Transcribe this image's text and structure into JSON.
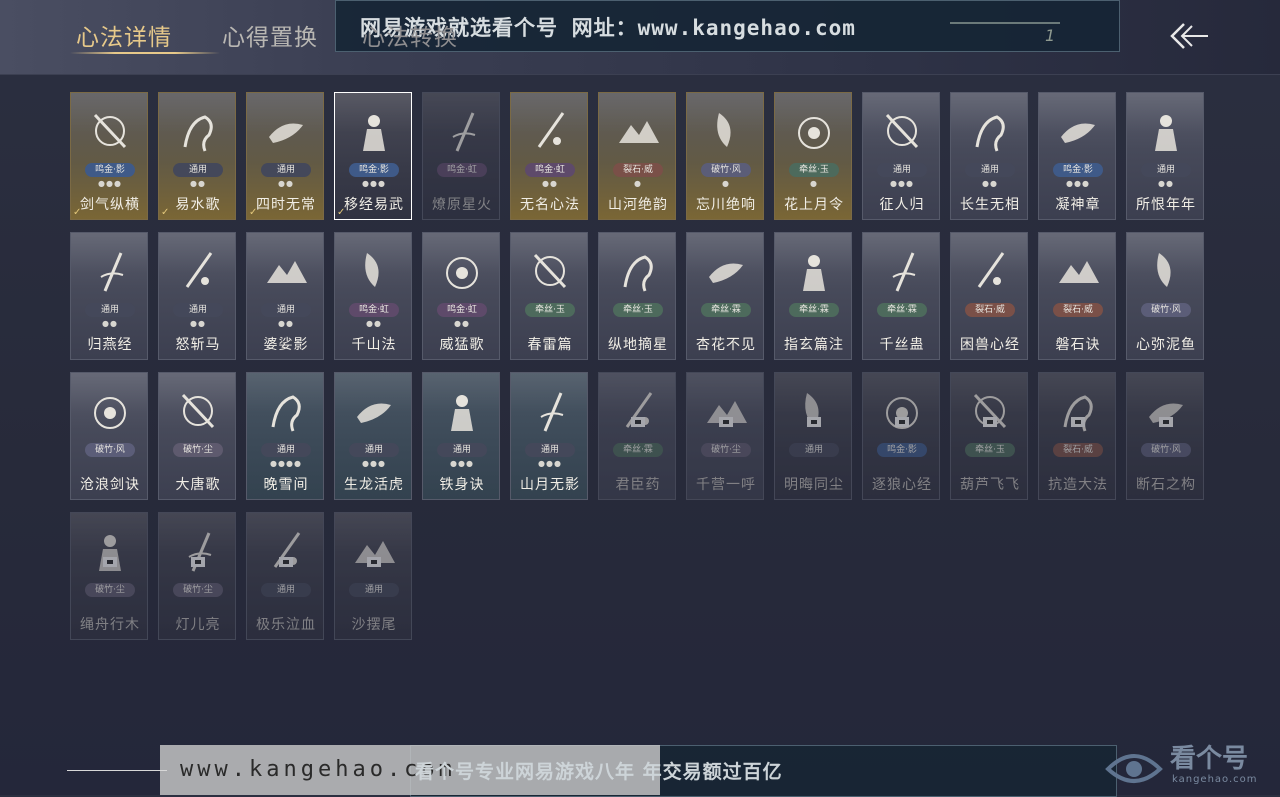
{
  "tabs": [
    {
      "label": "心法详情",
      "active": true
    },
    {
      "label": "心得置换",
      "active": false
    },
    {
      "label": "心法转换",
      "active": false
    }
  ],
  "watermark_top": "网易游戏就选看个号  网址：www.kangehao.com",
  "banner_number": "1",
  "bottom_url": "www.kangehao.com",
  "bottom_slogan": "看个号专业网易游戏八年  年交易额过百亿",
  "brand_name": "看个号",
  "brand_url": "kangehao.com",
  "cards": [
    {
      "name": "剑气纵横",
      "badge": "鸣金·影",
      "dots": "●●●",
      "style": "gold",
      "badge_style": "b-ying",
      "checked": true
    },
    {
      "name": "易水歌",
      "badge": "通用",
      "dots": "●●",
      "style": "gold",
      "badge_style": "b-common",
      "checked": true
    },
    {
      "name": "四时无常",
      "badge": "通用",
      "dots": "●●",
      "style": "gold",
      "badge_style": "b-common",
      "checked": true
    },
    {
      "name": "移经易武",
      "badge": "鸣金·影",
      "dots": "●●●",
      "style": "dark",
      "badge_style": "b-ying",
      "checked": true,
      "selected": true
    },
    {
      "name": "燎原星火",
      "badge": "鸣金·虹",
      "dots": "",
      "style": "dark",
      "badge_style": "b-hong",
      "faded": true
    },
    {
      "name": "无名心法",
      "badge": "鸣金·虹",
      "dots": "●●",
      "style": "gold",
      "badge_style": "b-hong"
    },
    {
      "name": "山河绝韵",
      "badge": "裂石·威",
      "dots": "●",
      "style": "gold",
      "badge_style": "b-wei"
    },
    {
      "name": "忘川绝响",
      "badge": "破竹·风",
      "dots": "●",
      "style": "gold",
      "badge_style": "b-feng"
    },
    {
      "name": "花上月令",
      "badge": "牵丝·玉",
      "dots": "●",
      "style": "gold",
      "badge_style": "b-yu"
    },
    {
      "name": "征人归",
      "badge": "通用",
      "dots": "●●●",
      "style": "normal",
      "badge_style": "b-common"
    },
    {
      "name": "长生无相",
      "badge": "通用",
      "dots": "●●",
      "style": "normal",
      "badge_style": "b-common"
    },
    {
      "name": "凝神章",
      "badge": "鸣金·影",
      "dots": "●●●",
      "style": "normal",
      "badge_style": "b-ying"
    },
    {
      "name": "所恨年年",
      "badge": "通用",
      "dots": "●●",
      "style": "normal",
      "badge_style": "b-common"
    },
    {
      "name": "归燕经",
      "badge": "通用",
      "dots": "●●",
      "style": "normal",
      "badge_style": "b-common"
    },
    {
      "name": "怒斩马",
      "badge": "通用",
      "dots": "●●",
      "style": "normal",
      "badge_style": "b-common"
    },
    {
      "name": "婆娑影",
      "badge": "通用",
      "dots": "●●",
      "style": "normal",
      "badge_style": "b-common"
    },
    {
      "name": "千山法",
      "badge": "鸣金·虹",
      "dots": "●●",
      "style": "normal",
      "badge_style": "b-hong"
    },
    {
      "name": "威猛歌",
      "badge": "鸣金·虹",
      "dots": "●●",
      "style": "normal",
      "badge_style": "b-hong"
    },
    {
      "name": "春雷篇",
      "badge": "牵丝·玉",
      "dots": "",
      "style": "normal",
      "badge_style": "b-yu"
    },
    {
      "name": "纵地摘星",
      "badge": "牵丝·玉",
      "dots": "",
      "style": "normal",
      "badge_style": "b-yu"
    },
    {
      "name": "杏花不见",
      "badge": "牵丝·霖",
      "dots": "",
      "style": "normal",
      "badge_style": "b-yu"
    },
    {
      "name": "指玄篇注",
      "badge": "牵丝·霖",
      "dots": "",
      "style": "normal",
      "badge_style": "b-yu"
    },
    {
      "name": "千丝蛊",
      "badge": "牵丝·霖",
      "dots": "",
      "style": "normal",
      "badge_style": "b-yu"
    },
    {
      "name": "困兽心经",
      "badge": "裂石·威",
      "dots": "",
      "style": "normal",
      "badge_style": "b-wei"
    },
    {
      "name": "磐石诀",
      "badge": "裂石·威",
      "dots": "",
      "style": "normal",
      "badge_style": "b-wei"
    },
    {
      "name": "心弥泥鱼",
      "badge": "破竹·风",
      "dots": "",
      "style": "normal",
      "badge_style": "b-feng"
    },
    {
      "name": "沧浪剑诀",
      "badge": "破竹·风",
      "dots": "",
      "style": "normal",
      "badge_style": "b-feng"
    },
    {
      "name": "大唐歌",
      "badge": "破竹·尘",
      "dots": "",
      "style": "normal",
      "badge_style": "b-chen"
    },
    {
      "name": "晚雪间",
      "badge": "通用",
      "dots": "●●●●",
      "style": "teal",
      "badge_style": "b-common"
    },
    {
      "name": "生龙活虎",
      "badge": "通用",
      "dots": "●●●",
      "style": "teal",
      "badge_style": "b-common"
    },
    {
      "name": "铁身诀",
      "badge": "通用",
      "dots": "●●●",
      "style": "teal",
      "badge_style": "b-common"
    },
    {
      "name": "山月无影",
      "badge": "通用",
      "dots": "●●●",
      "style": "teal",
      "badge_style": "b-common"
    },
    {
      "name": "君臣药",
      "badge": "牵丝·霖",
      "dots": "",
      "style": "normal",
      "badge_style": "b-yu",
      "locked": true
    },
    {
      "name": "千营一呼",
      "badge": "破竹·尘",
      "dots": "",
      "style": "normal",
      "badge_style": "b-chen",
      "locked": true
    },
    {
      "name": "明晦同尘",
      "badge": "通用",
      "dots": "",
      "style": "dark",
      "badge_style": "b-common",
      "locked": true
    },
    {
      "name": "逐狼心经",
      "badge": "鸣金·影",
      "dots": "",
      "style": "dark",
      "badge_style": "b-ying",
      "locked": true
    },
    {
      "name": "葫芦飞飞",
      "badge": "牵丝·玉",
      "dots": "",
      "style": "dark",
      "badge_style": "b-yu",
      "locked": true
    },
    {
      "name": "抗造大法",
      "badge": "裂石·威",
      "dots": "",
      "style": "dark",
      "badge_style": "b-wei",
      "locked": true
    },
    {
      "name": "断石之构",
      "badge": "破竹·风",
      "dots": "",
      "style": "dark",
      "badge_style": "b-feng",
      "locked": true
    },
    {
      "name": "绳舟行木",
      "badge": "破竹·尘",
      "dots": "",
      "style": "dark",
      "badge_style": "b-chen",
      "locked": true
    },
    {
      "name": "灯儿亮",
      "badge": "破竹·尘",
      "dots": "",
      "style": "dark",
      "badge_style": "b-chen",
      "locked": true
    },
    {
      "name": "极乐泣血",
      "badge": "通用",
      "dots": "",
      "style": "dark",
      "badge_style": "b-common",
      "locked": true
    },
    {
      "name": "沙摆尾",
      "badge": "通用",
      "dots": "",
      "style": "dark",
      "badge_style": "b-common",
      "locked": true
    }
  ]
}
